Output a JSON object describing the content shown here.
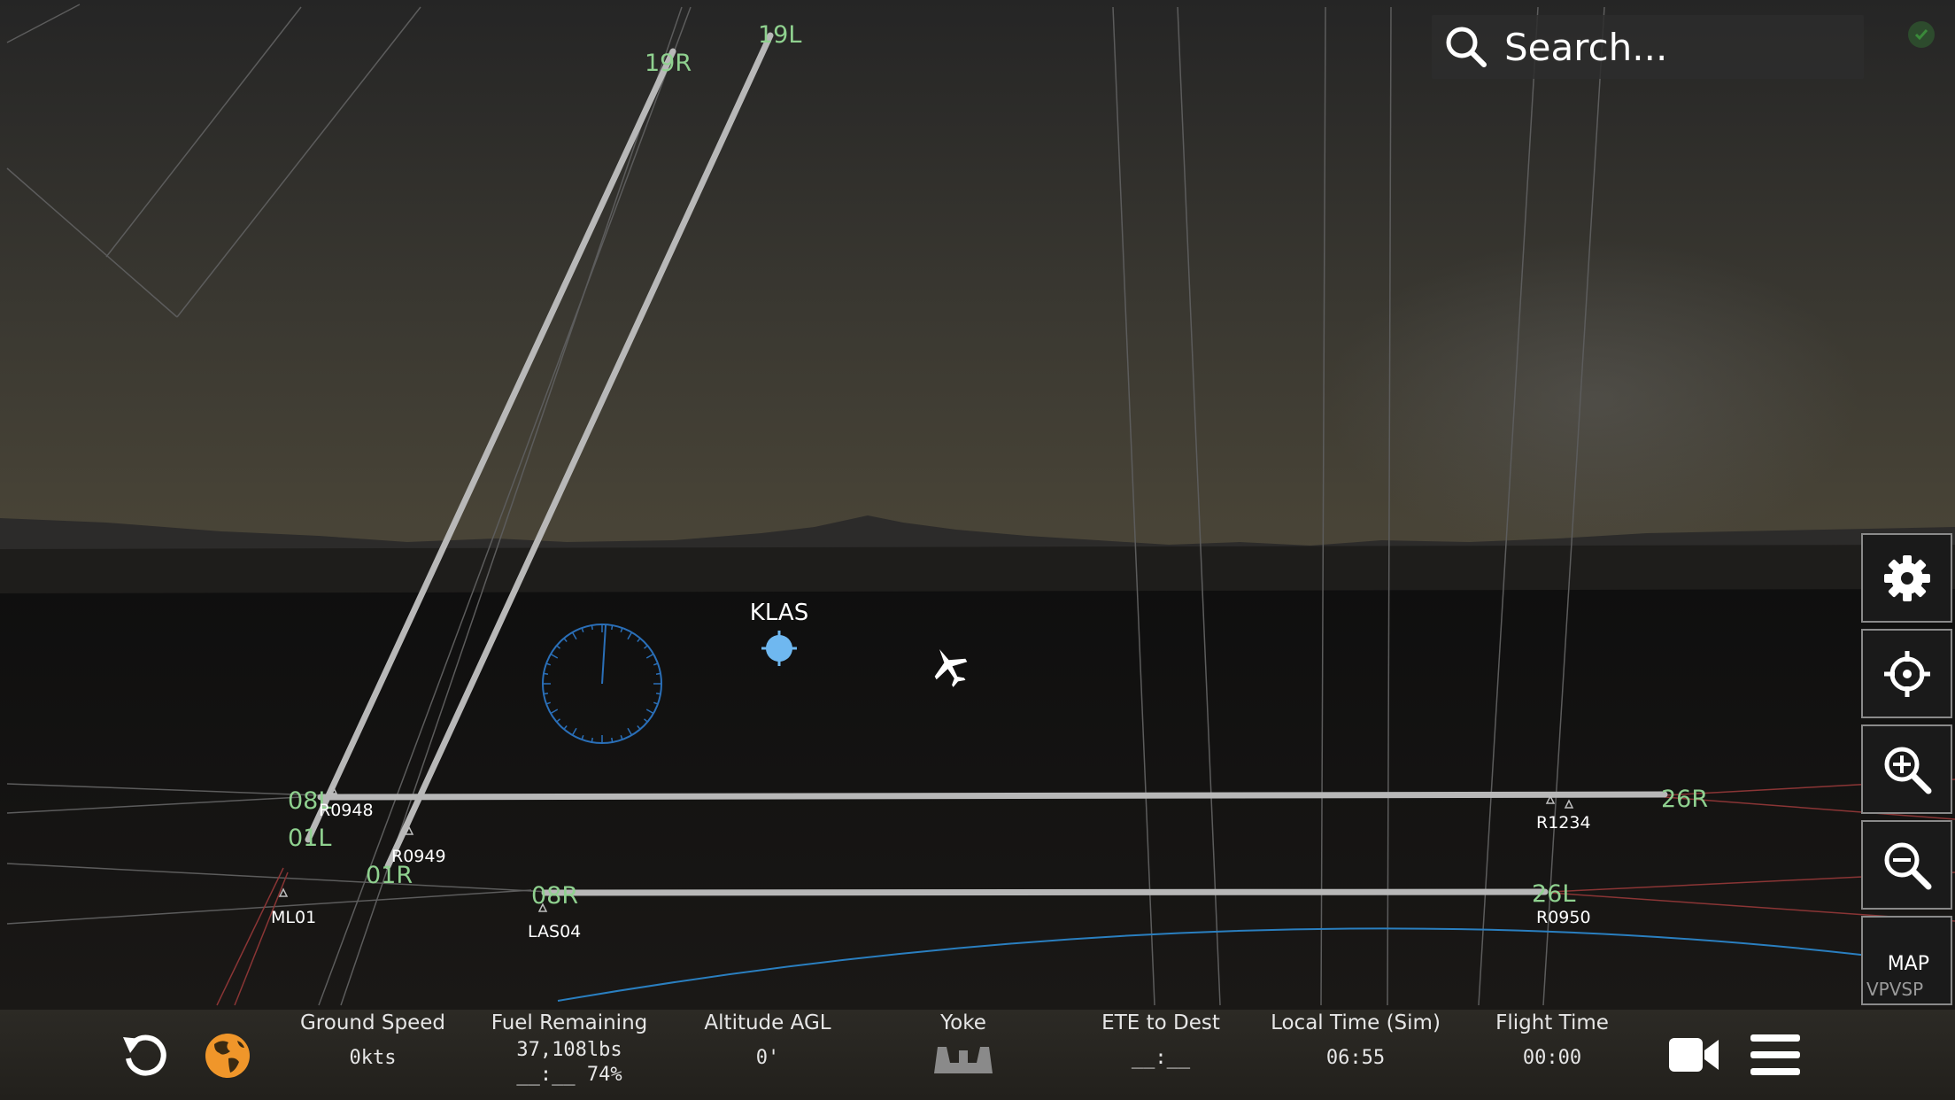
{
  "search": {
    "placeholder": "Search..."
  },
  "airport": {
    "code": "KLAS"
  },
  "runways": {
    "r19R": "19R",
    "r19L": "19L",
    "r08L": "08L",
    "r01L": "01L",
    "r01R": "01R",
    "r08R": "08R",
    "r26R": "26R",
    "r26L": "26L"
  },
  "waypoints": {
    "R0948": "R0948",
    "R0949": "R0949",
    "ML01": "ML01",
    "LAS04": "LAS04",
    "R1234": "R1234",
    "R0950": "R0950"
  },
  "side_buttons": {
    "map_label": "MAP",
    "vpvsp_label": "VPVSP"
  },
  "stats": {
    "ground_speed": {
      "label": "Ground Speed",
      "value": "0kts"
    },
    "fuel_remaining": {
      "label": "Fuel Remaining",
      "value": "37,108lbs",
      "value2": "__:__ 74%"
    },
    "altitude_agl": {
      "label": "Altitude AGL",
      "value": "0'"
    },
    "yoke": {
      "label": "Yoke"
    },
    "ete_to_dest": {
      "label": "ETE to Dest",
      "value": "__:__"
    },
    "local_time": {
      "label": "Local Time (Sim)",
      "value": "06:55"
    },
    "flight_time": {
      "label": "Flight Time",
      "value": "00:00"
    }
  },
  "colors": {
    "runway_label": "#8fd18f",
    "accent_orange": "#f0962a",
    "route_blue": "#2a7fc0",
    "target_blue": "#6fb8f0"
  },
  "icons": {
    "search": "search-icon",
    "status": "status-check-icon",
    "settings": "gear-icon",
    "center": "crosshair-icon",
    "zoom_in": "zoom-in-icon",
    "zoom_out": "zoom-out-icon",
    "reset": "reset-icon",
    "globe": "globe-icon",
    "camera": "camera-icon",
    "menu": "menu-icon",
    "yoke": "yoke-icon",
    "aircraft": "airplane-icon"
  }
}
